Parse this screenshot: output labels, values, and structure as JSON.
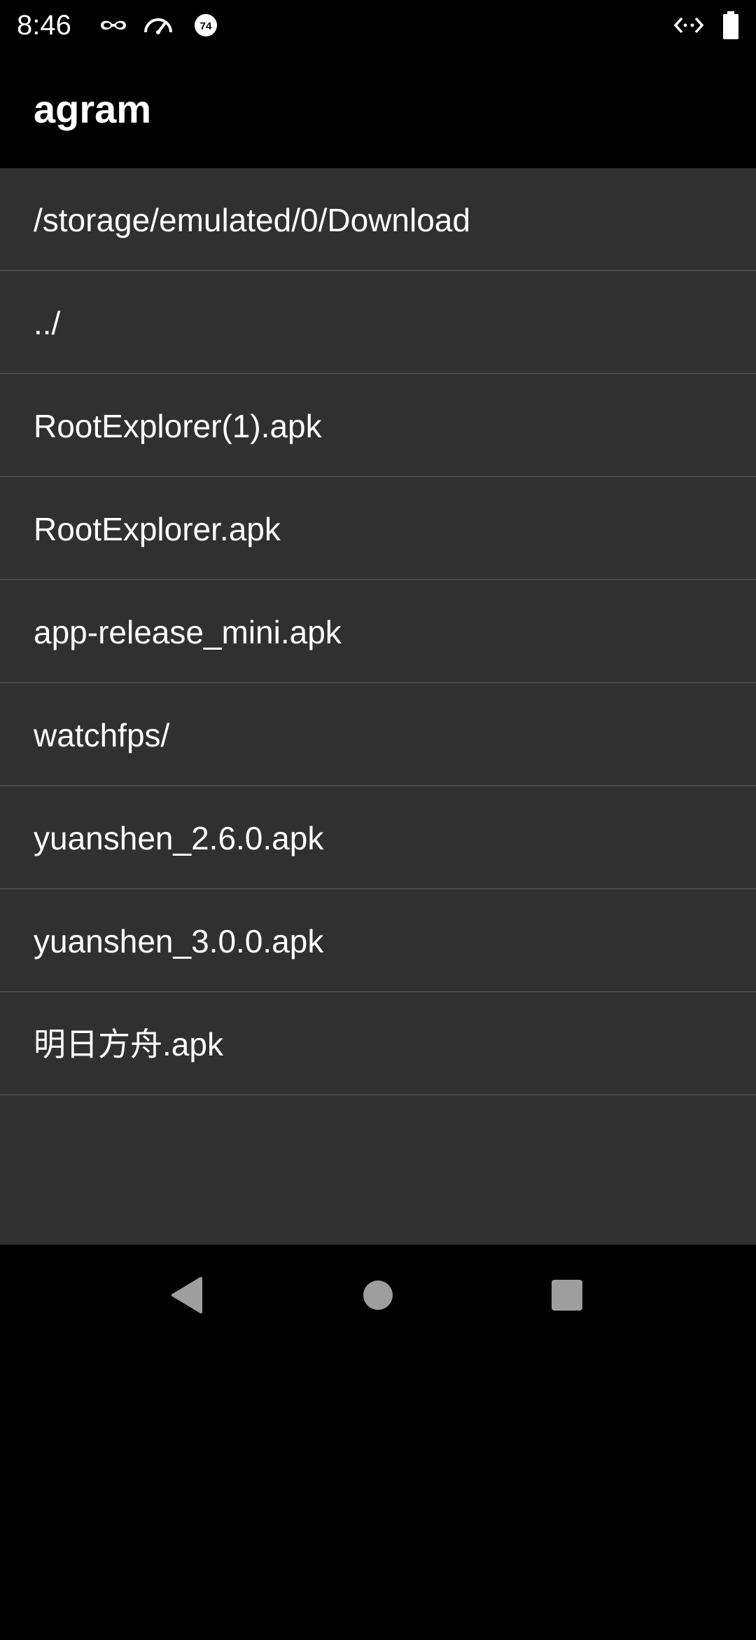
{
  "status_bar": {
    "time": "8:46",
    "icons": [
      "incognito-icon",
      "speedometer-icon",
      "badge-74-icon",
      "code-arrows-icon",
      "battery-icon"
    ],
    "badge_text": "74"
  },
  "app_bar": {
    "title": "agram"
  },
  "file_list": {
    "items": [
      {
        "label": "/storage/emulated/0/Download"
      },
      {
        "label": "../"
      },
      {
        "label": "RootExplorer(1).apk"
      },
      {
        "label": "RootExplorer.apk"
      },
      {
        "label": "app-release_mini.apk"
      },
      {
        "label": "watchfps/"
      },
      {
        "label": "yuanshen_2.6.0.apk"
      },
      {
        "label": "yuanshen_3.0.0.apk"
      },
      {
        "label": "明日方舟.apk"
      }
    ]
  },
  "nav_bar": {
    "icons": [
      "back-icon",
      "home-icon",
      "recents-icon"
    ]
  },
  "colors": {
    "background": "#000000",
    "list_background": "#303030",
    "divider": "#4a4a4a",
    "text": "#ffffff",
    "nav_icon": "#9e9e9e"
  }
}
